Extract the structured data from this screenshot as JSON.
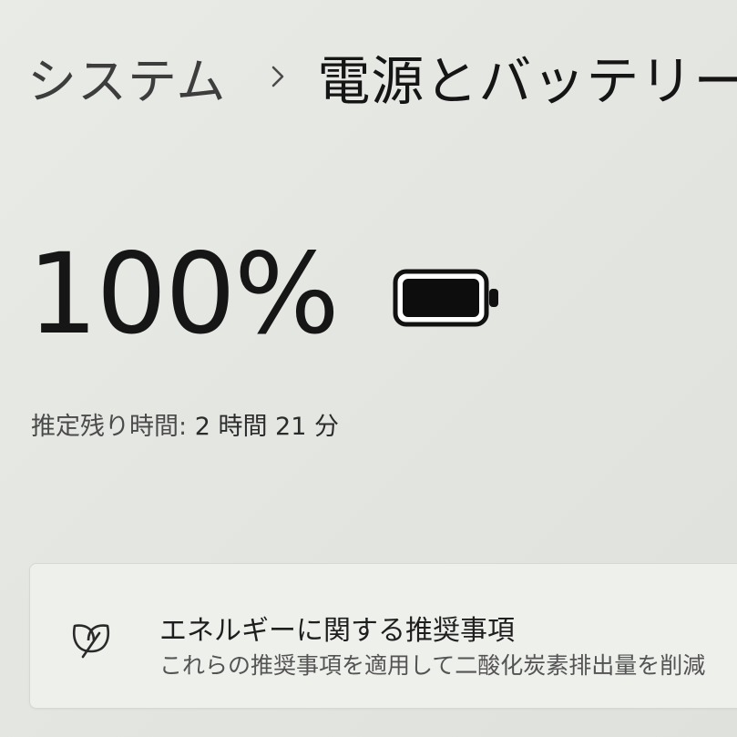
{
  "breadcrumb": {
    "parent": "システム",
    "separator_icon": "chevron-right-icon",
    "current": "電源とバッテリー"
  },
  "battery": {
    "percent_text": "100%",
    "level": 1.0,
    "icon": "battery-full-icon"
  },
  "estimate": {
    "label": "推定残り時間:",
    "value": "2 時間 21 分"
  },
  "energy_card": {
    "icon": "leaf-icon",
    "title": "エネルギーに関する推奨事項",
    "description": "これらの推奨事項を適用して二酸化炭素排出量を削減"
  }
}
